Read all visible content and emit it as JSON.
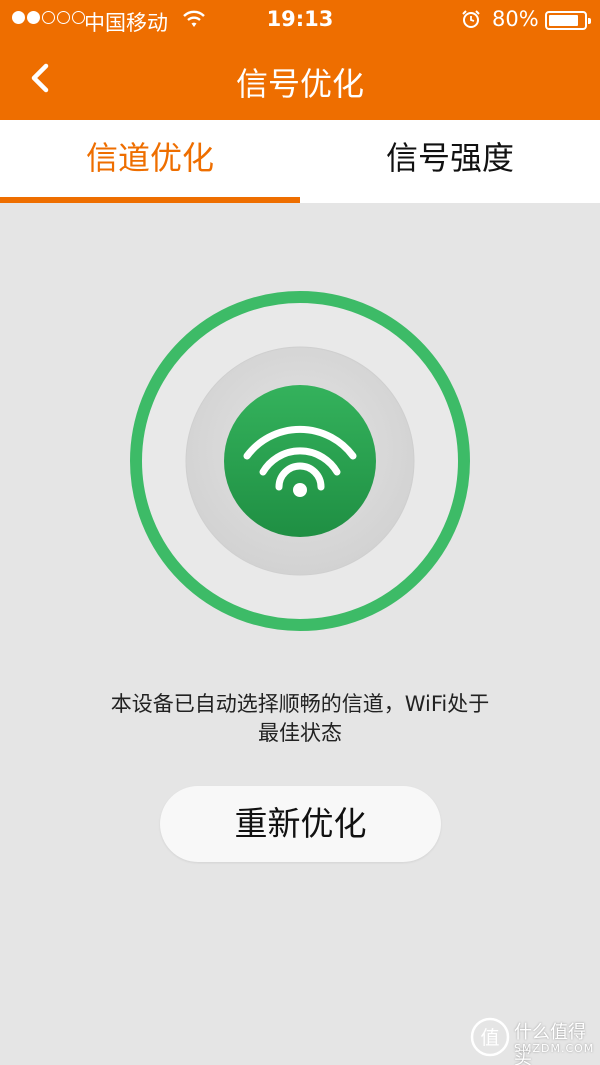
{
  "status_bar": {
    "carrier": "中国移动",
    "time": "19:13",
    "battery": "80%",
    "signal_dots_filled": 2,
    "signal_dots_total": 5,
    "battery_level": 0.8,
    "icons": [
      "signal-dots-icon",
      "wifi-status-icon",
      "alarm-icon",
      "battery-icon"
    ]
  },
  "nav": {
    "title": "信号优化",
    "back_icon": "chevron-left-icon"
  },
  "tabs": [
    {
      "label": "信道优化",
      "active": true
    },
    {
      "label": "信号强度",
      "active": false
    }
  ],
  "optimizer": {
    "icon": "wifi-icon",
    "message_line1": "本设备已自动选择顺畅的信道，WiFi处于",
    "message_line2": "最佳状态",
    "button_label": "重新优化"
  },
  "watermark": {
    "badge_char": "值",
    "text": "什么值得买",
    "domain": "SMZDM.COM"
  },
  "colors": {
    "accent": "#ee6e00",
    "ring_green": "#3dbb67",
    "wifi_green": "#2da653",
    "background": "#e5e5e5"
  }
}
